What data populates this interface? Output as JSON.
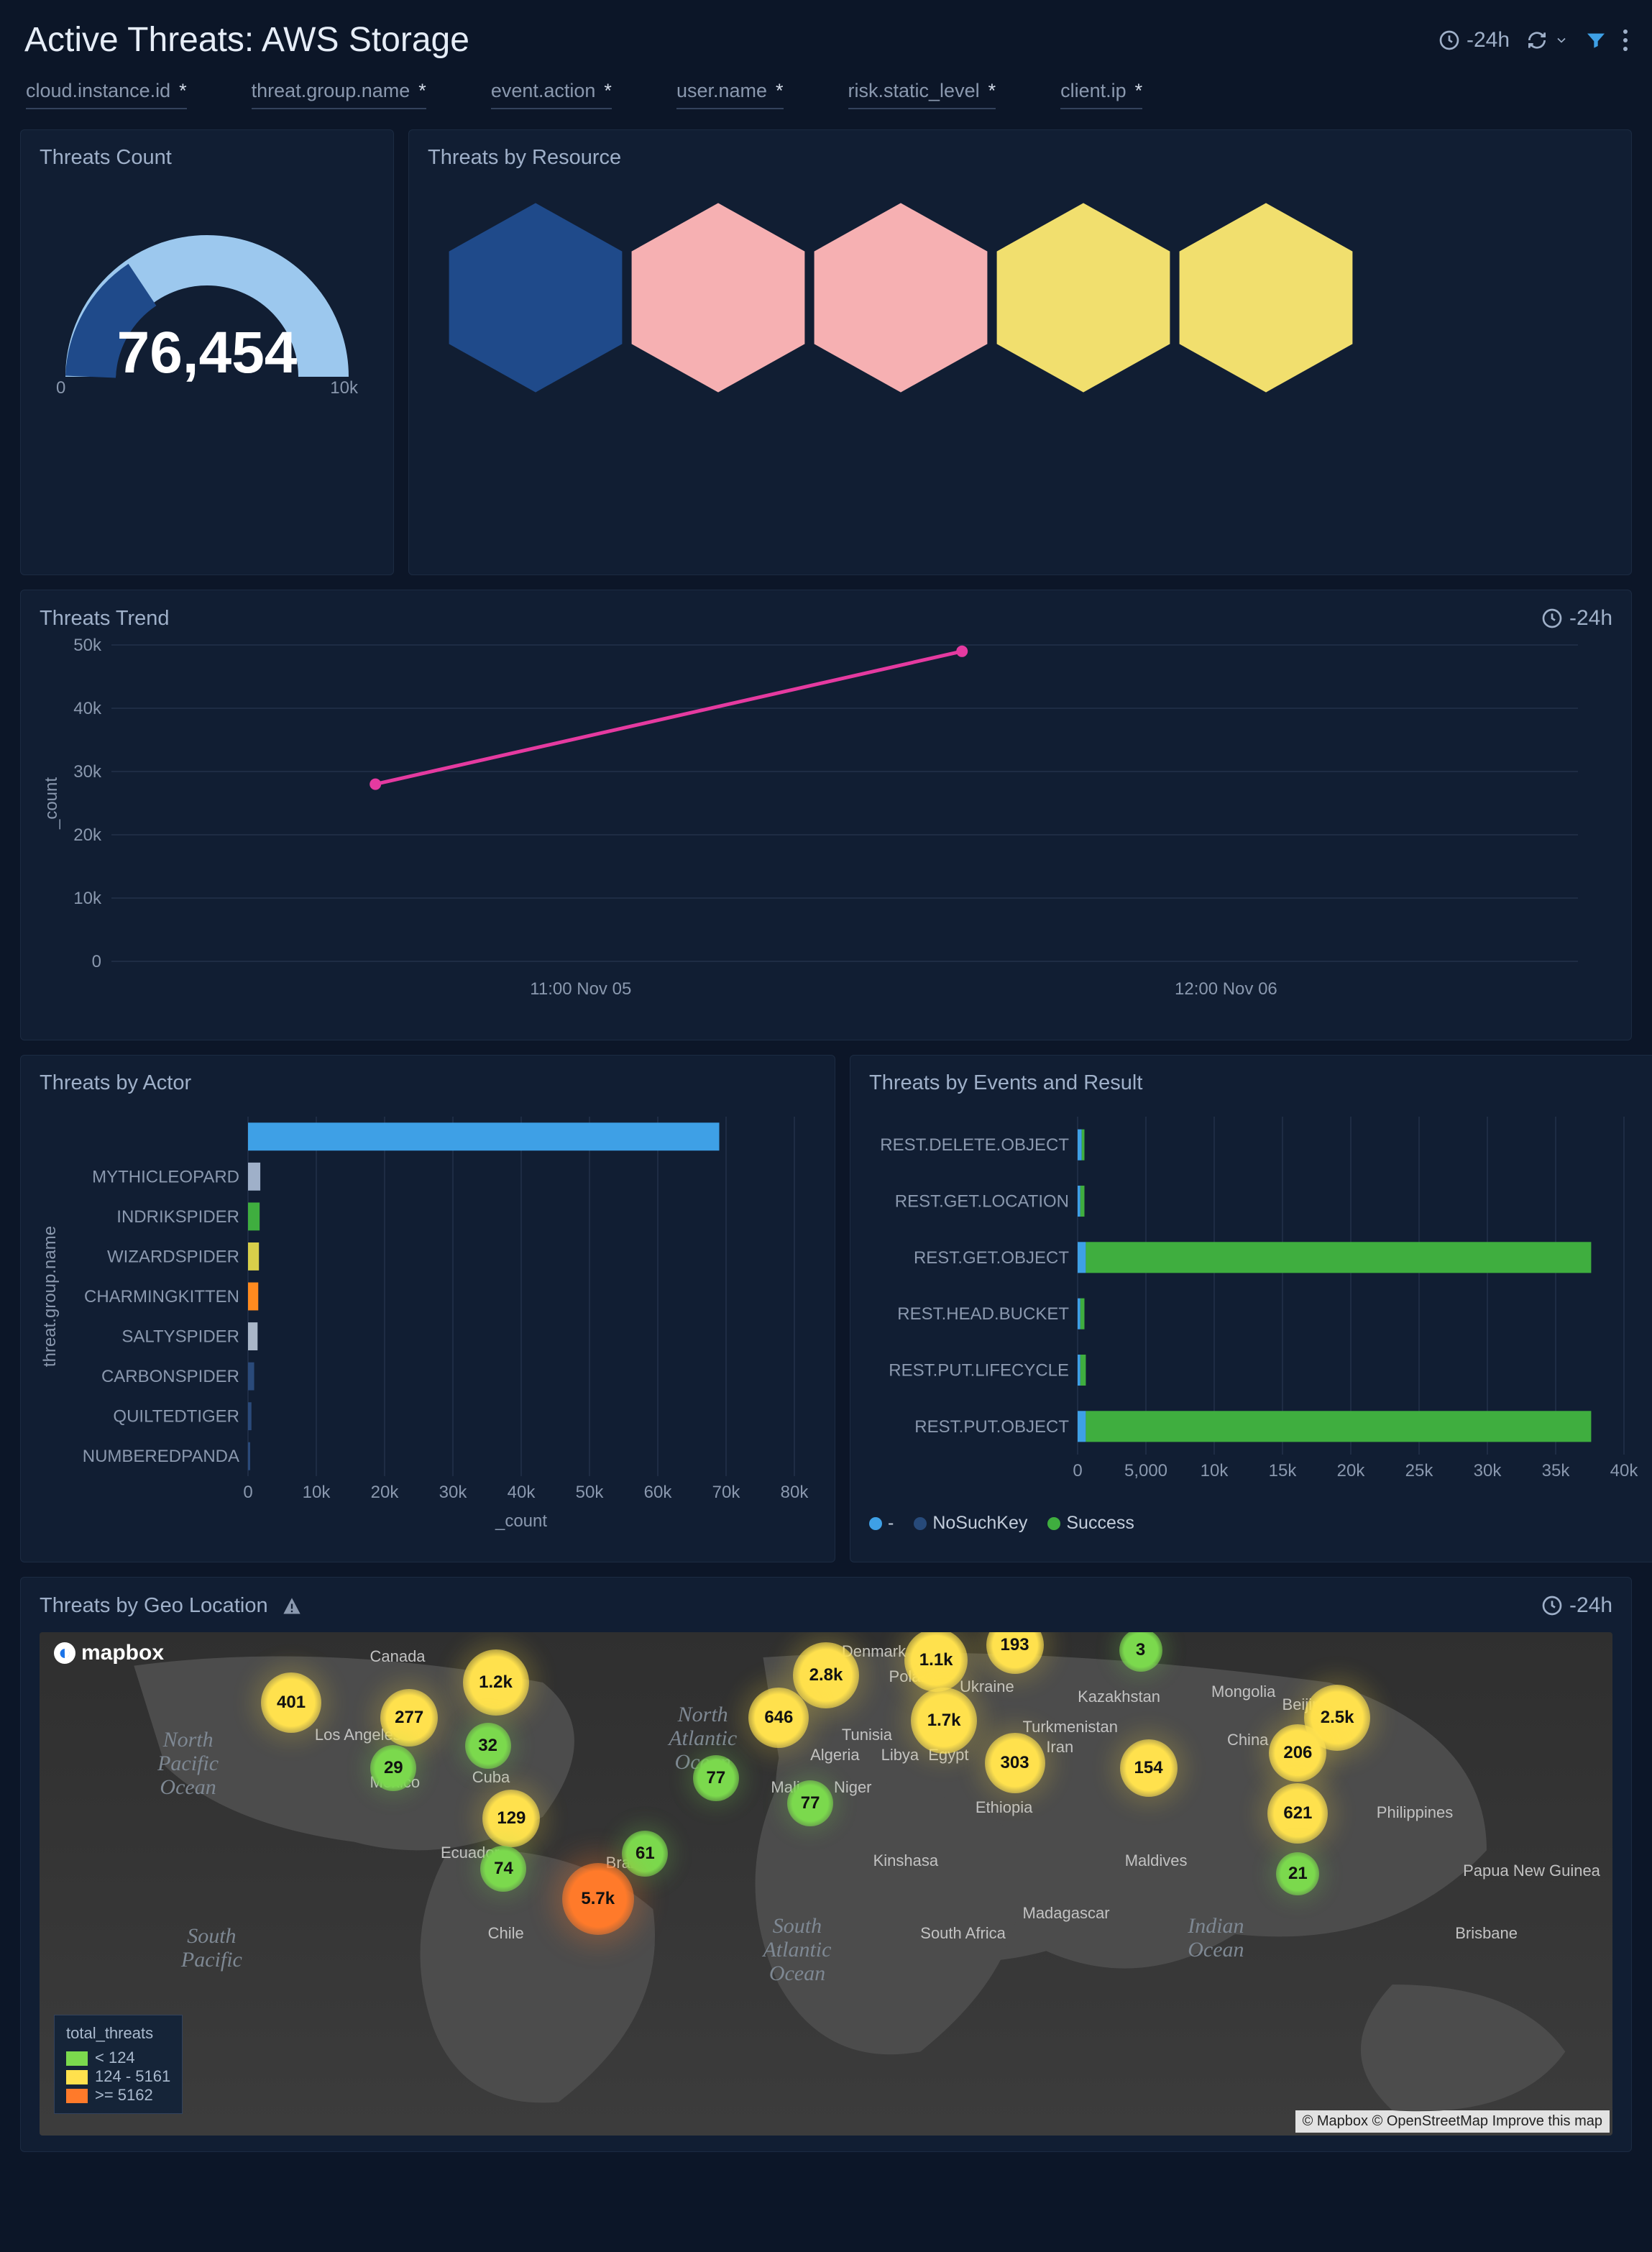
{
  "header": {
    "title": "Active Threats: AWS Storage",
    "time_range": "-24h"
  },
  "filters": [
    {
      "name": "cloud.instance.id",
      "value": "*"
    },
    {
      "name": "threat.group.name",
      "value": "*"
    },
    {
      "name": "event.action",
      "value": "*"
    },
    {
      "name": "user.name",
      "value": "*"
    },
    {
      "name": "risk.static_level",
      "value": "*"
    },
    {
      "name": "client.ip",
      "value": "*"
    }
  ],
  "panels": {
    "threats_count": {
      "title": "Threats Count",
      "value": "76,454",
      "min": "0",
      "max": "10k"
    },
    "threats_by_resource": {
      "title": "Threats by Resource"
    },
    "threats_trend": {
      "title": "Threats Trend",
      "time_range": "-24h"
    },
    "threats_by_actor": {
      "title": "Threats by Actor"
    },
    "threats_by_events": {
      "title": "Threats by Events and Result",
      "legend": {
        "dash": "-",
        "nokey": "NoSuchKey",
        "success": "Success"
      }
    },
    "threats_by_geo": {
      "title": "Threats by Geo Location",
      "time_range": "-24h"
    }
  },
  "chart_data": [
    {
      "id": "threats_count",
      "type": "gauge",
      "value": 76454,
      "min": 0,
      "max": 10000,
      "title": "Threats Count"
    },
    {
      "id": "threats_by_resource",
      "type": "hex",
      "title": "Threats by Resource",
      "series": [
        {
          "color": "#1f4a8a"
        },
        {
          "color": "#f6b0b2"
        },
        {
          "color": "#f6b0b2"
        },
        {
          "color": "#f1df6e"
        },
        {
          "color": "#f1df6e"
        }
      ]
    },
    {
      "id": "threats_trend",
      "type": "line",
      "title": "Threats Trend",
      "xlabel": "",
      "ylabel": "_count",
      "x": [
        "11:00 Nov 05",
        "12:00 Nov 06"
      ],
      "ylim": [
        0,
        50000
      ],
      "yticks": [
        0,
        10000,
        20000,
        30000,
        40000,
        50000
      ],
      "yticklabels": [
        "0",
        "10k",
        "20k",
        "30k",
        "40k",
        "50k"
      ],
      "series": [
        {
          "name": "count",
          "color": "#e53aa0",
          "values": [
            28000,
            49000
          ]
        }
      ]
    },
    {
      "id": "threats_by_actor",
      "type": "bar",
      "orientation": "horizontal",
      "title": "Threats by Actor",
      "xlabel": "_count",
      "ylabel": "threat.group.name",
      "xlim": [
        0,
        80000
      ],
      "xticks": [
        0,
        10000,
        20000,
        30000,
        40000,
        50000,
        60000,
        70000,
        80000
      ],
      "xticklabels": [
        "0",
        "10k",
        "20k",
        "30k",
        "40k",
        "50k",
        "60k",
        "70k",
        "80k"
      ],
      "categories": [
        "",
        "MYTHICLEOPARD",
        "INDRIKSPIDER",
        "WIZARDSPIDER",
        "CHARMINGKITTEN",
        "SALTYSPIDER",
        "CARBONSPIDER",
        "QUILTEDTIGER",
        "NUMBEREDPANDA"
      ],
      "values": [
        69000,
        1800,
        1700,
        1600,
        1500,
        1400,
        900,
        500,
        300
      ],
      "colors": [
        "#3ea0e6",
        "#9fb0c9",
        "#3fae3f",
        "#d8cf4a",
        "#ff8a1f",
        "#a9b6c8",
        "#2a4a7a",
        "#2a4a7a",
        "#2a4a7a"
      ]
    },
    {
      "id": "threats_by_events",
      "type": "bar",
      "orientation": "horizontal",
      "stacked": true,
      "title": "Threats by Events and Result",
      "xlabel": "",
      "ylabel": "",
      "xlim": [
        0,
        40000
      ],
      "xticks": [
        0,
        5000,
        10000,
        15000,
        20000,
        25000,
        30000,
        35000,
        40000
      ],
      "xticklabels": [
        "0",
        "5,000",
        "10k",
        "15k",
        "20k",
        "25k",
        "30k",
        "35k",
        "40k"
      ],
      "categories": [
        "REST.DELETE.OBJECT",
        "REST.GET.LOCATION",
        "REST.GET.OBJECT",
        "REST.HEAD.BUCKET",
        "REST.PUT.LIFECYCLE",
        "REST.PUT.OBJECT"
      ],
      "series": [
        {
          "name": "-",
          "color": "#3ea0e6",
          "values": [
            300,
            200,
            600,
            200,
            200,
            600
          ]
        },
        {
          "name": "NoSuchKey",
          "color": "#274a7a",
          "values": [
            0,
            0,
            0,
            0,
            0,
            0
          ]
        },
        {
          "name": "Success",
          "color": "#3fae3f",
          "values": [
            200,
            300,
            37000,
            300,
            400,
            37000
          ]
        }
      ]
    },
    {
      "id": "threats_by_geo",
      "type": "map",
      "title": "Threats by Geo Location",
      "legend": {
        "title": "total_threats",
        "bins": [
          {
            "label": "< 124",
            "color": "#7bd94d"
          },
          {
            "label": "124 - 5161",
            "color": "#ffe14d"
          },
          {
            "label": ">= 5162",
            "color": "#ff7a2a"
          }
        ]
      },
      "attribution": "© Mapbox © OpenStreetMap Improve this map",
      "points": [
        {
          "label": "401",
          "class": "y",
          "x": 0.16,
          "y": 0.14,
          "r": 42
        },
        {
          "label": "277",
          "class": "y",
          "x": 0.235,
          "y": 0.17,
          "r": 40
        },
        {
          "label": "1.2k",
          "class": "y",
          "x": 0.29,
          "y": 0.1,
          "r": 46
        },
        {
          "label": "32",
          "class": "g",
          "x": 0.285,
          "y": 0.225,
          "r": 32
        },
        {
          "label": "29",
          "class": "g",
          "x": 0.225,
          "y": 0.27,
          "r": 32
        },
        {
          "label": "129",
          "class": "y",
          "x": 0.3,
          "y": 0.37,
          "r": 40
        },
        {
          "label": "74",
          "class": "g",
          "x": 0.295,
          "y": 0.47,
          "r": 32
        },
        {
          "label": "61",
          "class": "g",
          "x": 0.385,
          "y": 0.44,
          "r": 32
        },
        {
          "label": "5.7k",
          "class": "o",
          "x": 0.355,
          "y": 0.53,
          "r": 50
        },
        {
          "label": "2.8k",
          "class": "y",
          "x": 0.5,
          "y": 0.085,
          "r": 46
        },
        {
          "label": "646",
          "class": "y",
          "x": 0.47,
          "y": 0.17,
          "r": 42
        },
        {
          "label": "77",
          "class": "g",
          "x": 0.43,
          "y": 0.29,
          "r": 32
        },
        {
          "label": "77",
          "class": "g",
          "x": 0.49,
          "y": 0.34,
          "r": 32
        },
        {
          "label": "1.1k",
          "class": "y",
          "x": 0.57,
          "y": 0.055,
          "r": 44
        },
        {
          "label": "1.7k",
          "class": "y",
          "x": 0.575,
          "y": 0.175,
          "r": 46
        },
        {
          "label": "303",
          "class": "y",
          "x": 0.62,
          "y": 0.26,
          "r": 42
        },
        {
          "label": "193",
          "class": "y",
          "x": 0.62,
          "y": 0.025,
          "r": 40
        },
        {
          "label": "3",
          "class": "g",
          "x": 0.7,
          "y": 0.035,
          "r": 30
        },
        {
          "label": "154",
          "class": "y",
          "x": 0.705,
          "y": 0.27,
          "r": 40
        },
        {
          "label": "2.5k",
          "class": "y",
          "x": 0.825,
          "y": 0.17,
          "r": 46
        },
        {
          "label": "206",
          "class": "y",
          "x": 0.8,
          "y": 0.24,
          "r": 40
        },
        {
          "label": "621",
          "class": "y",
          "x": 0.8,
          "y": 0.36,
          "r": 42
        },
        {
          "label": "21",
          "class": "g",
          "x": 0.8,
          "y": 0.48,
          "r": 30
        }
      ],
      "labels": [
        {
          "text": "North Pacific Ocean",
          "x": 0.075,
          "y": 0.19,
          "italic": true
        },
        {
          "text": "North Atlantic Ocean",
          "x": 0.4,
          "y": 0.14,
          "italic": true
        },
        {
          "text": "South Atlantic Ocean",
          "x": 0.46,
          "y": 0.56,
          "italic": true
        },
        {
          "text": "Indian Ocean",
          "x": 0.73,
          "y": 0.56,
          "italic": true
        },
        {
          "text": "South Pacific",
          "x": 0.09,
          "y": 0.58,
          "italic": true
        }
      ],
      "cities": [
        {
          "text": "Los Angeles",
          "x": 0.175,
          "y": 0.185
        },
        {
          "text": "Canada",
          "x": 0.21,
          "y": 0.03
        },
        {
          "text": "Denmark",
          "x": 0.51,
          "y": 0.02
        },
        {
          "text": "Poland",
          "x": 0.54,
          "y": 0.07
        },
        {
          "text": "Ukraine",
          "x": 0.585,
          "y": 0.09
        },
        {
          "text": "Kazakhstan",
          "x": 0.66,
          "y": 0.11
        },
        {
          "text": "Mongolia",
          "x": 0.745,
          "y": 0.1
        },
        {
          "text": "Beijing",
          "x": 0.79,
          "y": 0.125
        },
        {
          "text": "China",
          "x": 0.755,
          "y": 0.195
        },
        {
          "text": "Turkmenistan",
          "x": 0.625,
          "y": 0.17
        },
        {
          "text": "Iran",
          "x": 0.64,
          "y": 0.21
        },
        {
          "text": "Tunisia",
          "x": 0.51,
          "y": 0.185
        },
        {
          "text": "Algeria",
          "x": 0.49,
          "y": 0.225
        },
        {
          "text": "Libya",
          "x": 0.535,
          "y": 0.225
        },
        {
          "text": "Egypt",
          "x": 0.565,
          "y": 0.225
        },
        {
          "text": "Mali",
          "x": 0.465,
          "y": 0.29
        },
        {
          "text": "Niger",
          "x": 0.505,
          "y": 0.29
        },
        {
          "text": "Ethiopia",
          "x": 0.595,
          "y": 0.33
        },
        {
          "text": "Kinshasa",
          "x": 0.53,
          "y": 0.435
        },
        {
          "text": "Madagascar",
          "x": 0.625,
          "y": 0.54
        },
        {
          "text": "Maldives",
          "x": 0.69,
          "y": 0.435
        },
        {
          "text": "Philippines",
          "x": 0.85,
          "y": 0.34
        },
        {
          "text": "Papua New Guinea",
          "x": 0.905,
          "y": 0.455
        },
        {
          "text": "Brisbane",
          "x": 0.9,
          "y": 0.58
        },
        {
          "text": "Chile",
          "x": 0.285,
          "y": 0.58
        },
        {
          "text": "Brazil",
          "x": 0.36,
          "y": 0.44
        },
        {
          "text": "Ecuador",
          "x": 0.255,
          "y": 0.42
        },
        {
          "text": "Mexico",
          "x": 0.21,
          "y": 0.28
        },
        {
          "text": "Cuba",
          "x": 0.275,
          "y": 0.27
        },
        {
          "text": "South Africa",
          "x": 0.56,
          "y": 0.58
        }
      ]
    }
  ],
  "colors": {
    "accent": "#3ea0e6",
    "pink": "#e53aa0",
    "green": "#3fae3f",
    "panel": "#111e33"
  }
}
